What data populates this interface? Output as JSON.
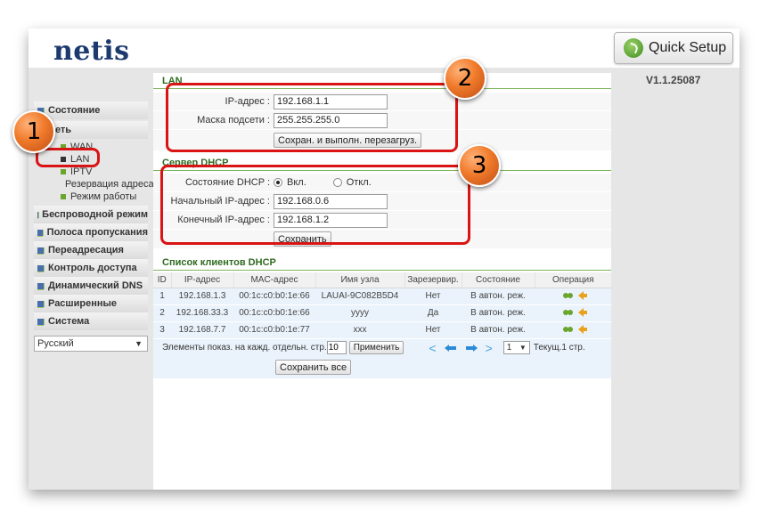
{
  "header": {
    "logo_text": "netis",
    "quick_setup_label": "Quick Setup",
    "version": "V1.1.25087"
  },
  "sidebar": {
    "status": "Состояние",
    "network": "Сеть",
    "network_subitems": [
      "WAN",
      "LAN",
      "IPTV",
      "Резервация адреса",
      "Режим работы"
    ],
    "items": [
      "Беспроводной режим",
      "Полоса пропускания",
      "Переадресация",
      "Контроль доступа",
      "Динамический DNS",
      "Расширенные",
      "Система"
    ],
    "language": "Русский"
  },
  "lan": {
    "title": "LAN",
    "ip_label": "IP-адрес :",
    "ip_value": "192.168.1.1",
    "mask_label": "Маска подсети :",
    "mask_value": "255.255.255.0",
    "save_button": "Сохран. и выполн. перезагруз."
  },
  "dhcp": {
    "title": "Сервер DHCP",
    "state_label": "Состояние DHCP :",
    "on_label": "Вкл.",
    "off_label": "Откл.",
    "start_label": "Начальный IP-адрес :",
    "start_value": "192.168.0.6",
    "end_label": "Конечный IP-адрес :",
    "end_value": "192.168.1.2",
    "save_button": "Сохранить"
  },
  "clients": {
    "title": "Список клиентов DHCP",
    "headers": [
      "ID",
      "IP-адрес",
      "MAC-адрес",
      "Имя узла",
      "Зарезервир.",
      "Состояние",
      "Операция"
    ],
    "rows": [
      [
        "1",
        "192.168.1.3",
        "00:1c:c0:b0:1e:66",
        "LAUAI-9C082B5D4",
        "Нет",
        "В автон. реж."
      ],
      [
        "2",
        "192.168.33.3",
        "00:1c:c0:b0:1e:66",
        "yyyy",
        "Да",
        "В автон. реж."
      ],
      [
        "3",
        "192.168.7.7",
        "00:1c:c0:b0:1e:77",
        "xxx",
        "Нет",
        "В автон. реж."
      ]
    ],
    "per_page_label": "Элементы показ. на кажд. отдельн. стр.",
    "per_page_value": "10",
    "apply_button": "Применить",
    "page_value": "1",
    "current_page": "Текущ.1 стр.",
    "save_all_button": "Сохранить все"
  },
  "annotations": {
    "badge1": "1",
    "badge2": "2",
    "badge3": "3",
    "highlight_color": "#d91414",
    "badge_color": "#f07a2a"
  },
  "icons": {
    "quick_setup": "refresh-arrow-icon",
    "menu_square": "menu-square-icon",
    "operation_edit": "key-icon",
    "operation_back": "arrow-left-icon"
  }
}
